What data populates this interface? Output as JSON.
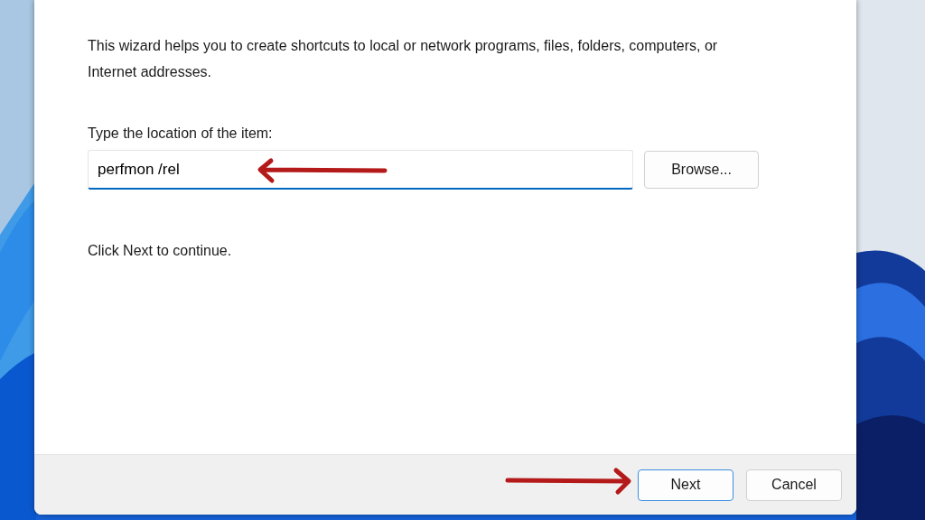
{
  "wizard": {
    "intro": "This wizard helps you to create shortcuts to local or network programs, files, folders, computers, or Internet addresses.",
    "location_label": "Type the location of the item:",
    "location_field": {
      "value": "perfmon /rel",
      "focused": true
    },
    "browse_button": "Browse...",
    "continue_hint": "Click Next to continue."
  },
  "buttons": [
    {
      "label": "Next",
      "default": true
    },
    {
      "label": "Cancel",
      "default": false
    }
  ],
  "annotations": [
    {
      "points_left": true
    },
    {
      "points_left": false
    }
  ]
}
